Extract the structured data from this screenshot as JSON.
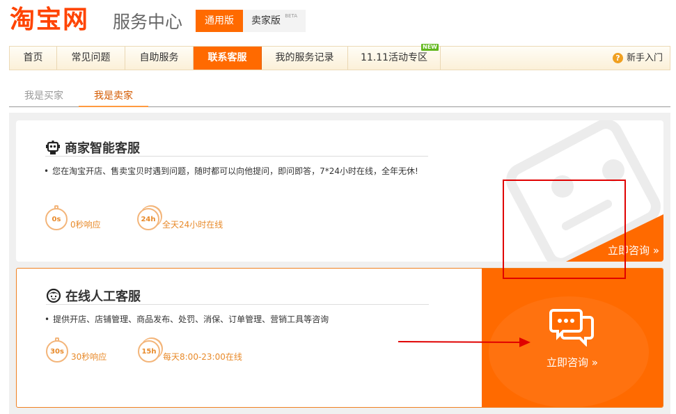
{
  "header": {
    "logo": "淘宝网",
    "subtitle": "服务中心",
    "versions": [
      {
        "label": "通用版"
      },
      {
        "label": "卖家版",
        "badge": "BETA"
      }
    ]
  },
  "nav": {
    "items": [
      {
        "label": "首页"
      },
      {
        "label": "常见问题"
      },
      {
        "label": "自助服务"
      },
      {
        "label": "联系客服"
      },
      {
        "label": "我的服务记录"
      },
      {
        "label": "11.11活动专区",
        "badge": "NEW"
      }
    ],
    "help": {
      "icon": "?",
      "label": "新手入门"
    }
  },
  "roles": [
    {
      "label": "我是买家"
    },
    {
      "label": "我是卖家"
    }
  ],
  "smart_service": {
    "title": "商家智能客服",
    "desc": "您在淘宝开店、售卖宝贝时遇到问题，随时都可以向他提问，即问即答，7*24小时在线，全年无休!",
    "stats": [
      {
        "badge": "0s",
        "label": "0秒响应"
      },
      {
        "badge": "24h",
        "label": "全天24小时在线"
      }
    ],
    "link": "立即咨询 »"
  },
  "human_service": {
    "title": "在线人工客服",
    "desc": "提供开店、店铺管理、商品发布、处罚、消保、订单管理、营销工具等咨询",
    "stats": [
      {
        "badge": "30s",
        "label": "30秒响应"
      },
      {
        "badge": "15h",
        "label": "每天8:00-23:00在线"
      }
    ],
    "link": "立即咨询 »"
  },
  "colors": {
    "brand_orange": "#ff6a00",
    "logo": "#ff4400",
    "highlight_box": "#e00000"
  }
}
